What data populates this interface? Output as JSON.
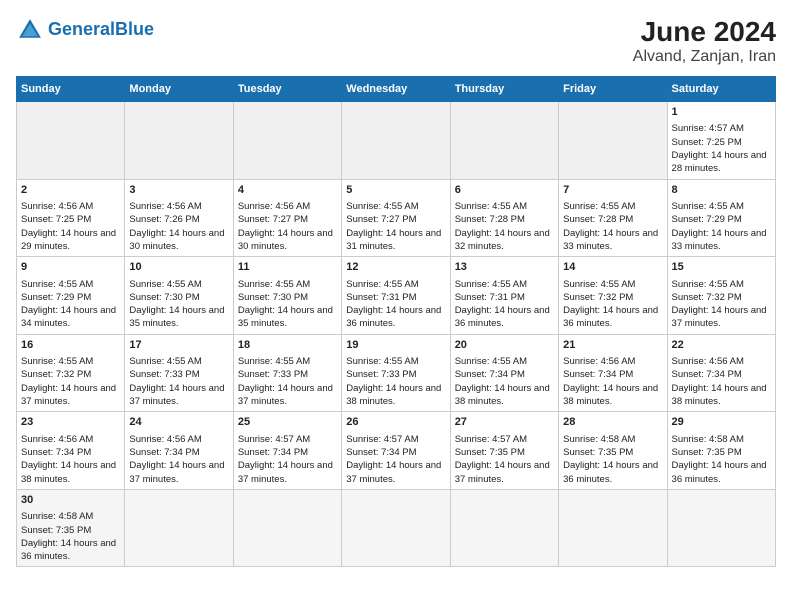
{
  "header": {
    "logo_general": "General",
    "logo_blue": "Blue",
    "title": "June 2024",
    "subtitle": "Alvand, Zanjan, Iran"
  },
  "weekdays": [
    "Sunday",
    "Monday",
    "Tuesday",
    "Wednesday",
    "Thursday",
    "Friday",
    "Saturday"
  ],
  "weeks": [
    [
      {
        "day": "",
        "info": ""
      },
      {
        "day": "",
        "info": ""
      },
      {
        "day": "",
        "info": ""
      },
      {
        "day": "",
        "info": ""
      },
      {
        "day": "",
        "info": ""
      },
      {
        "day": "",
        "info": ""
      },
      {
        "day": "1",
        "info": "Sunrise: 4:57 AM\nSunset: 7:25 PM\nDaylight: 14 hours and 28 minutes."
      }
    ],
    [
      {
        "day": "2",
        "info": "Sunrise: 4:56 AM\nSunset: 7:25 PM\nDaylight: 14 hours and 29 minutes."
      },
      {
        "day": "3",
        "info": "Sunrise: 4:56 AM\nSunset: 7:26 PM\nDaylight: 14 hours and 30 minutes."
      },
      {
        "day": "4",
        "info": "Sunrise: 4:56 AM\nSunset: 7:27 PM\nDaylight: 14 hours and 30 minutes."
      },
      {
        "day": "5",
        "info": "Sunrise: 4:55 AM\nSunset: 7:27 PM\nDaylight: 14 hours and 31 minutes."
      },
      {
        "day": "6",
        "info": "Sunrise: 4:55 AM\nSunset: 7:28 PM\nDaylight: 14 hours and 32 minutes."
      },
      {
        "day": "7",
        "info": "Sunrise: 4:55 AM\nSunset: 7:28 PM\nDaylight: 14 hours and 33 minutes."
      },
      {
        "day": "8",
        "info": "Sunrise: 4:55 AM\nSunset: 7:29 PM\nDaylight: 14 hours and 33 minutes."
      }
    ],
    [
      {
        "day": "9",
        "info": "Sunrise: 4:55 AM\nSunset: 7:29 PM\nDaylight: 14 hours and 34 minutes."
      },
      {
        "day": "10",
        "info": "Sunrise: 4:55 AM\nSunset: 7:30 PM\nDaylight: 14 hours and 35 minutes."
      },
      {
        "day": "11",
        "info": "Sunrise: 4:55 AM\nSunset: 7:30 PM\nDaylight: 14 hours and 35 minutes."
      },
      {
        "day": "12",
        "info": "Sunrise: 4:55 AM\nSunset: 7:31 PM\nDaylight: 14 hours and 36 minutes."
      },
      {
        "day": "13",
        "info": "Sunrise: 4:55 AM\nSunset: 7:31 PM\nDaylight: 14 hours and 36 minutes."
      },
      {
        "day": "14",
        "info": "Sunrise: 4:55 AM\nSunset: 7:32 PM\nDaylight: 14 hours and 36 minutes."
      },
      {
        "day": "15",
        "info": "Sunrise: 4:55 AM\nSunset: 7:32 PM\nDaylight: 14 hours and 37 minutes."
      }
    ],
    [
      {
        "day": "16",
        "info": "Sunrise: 4:55 AM\nSunset: 7:32 PM\nDaylight: 14 hours and 37 minutes."
      },
      {
        "day": "17",
        "info": "Sunrise: 4:55 AM\nSunset: 7:33 PM\nDaylight: 14 hours and 37 minutes."
      },
      {
        "day": "18",
        "info": "Sunrise: 4:55 AM\nSunset: 7:33 PM\nDaylight: 14 hours and 37 minutes."
      },
      {
        "day": "19",
        "info": "Sunrise: 4:55 AM\nSunset: 7:33 PM\nDaylight: 14 hours and 38 minutes."
      },
      {
        "day": "20",
        "info": "Sunrise: 4:55 AM\nSunset: 7:34 PM\nDaylight: 14 hours and 38 minutes."
      },
      {
        "day": "21",
        "info": "Sunrise: 4:56 AM\nSunset: 7:34 PM\nDaylight: 14 hours and 38 minutes."
      },
      {
        "day": "22",
        "info": "Sunrise: 4:56 AM\nSunset: 7:34 PM\nDaylight: 14 hours and 38 minutes."
      }
    ],
    [
      {
        "day": "23",
        "info": "Sunrise: 4:56 AM\nSunset: 7:34 PM\nDaylight: 14 hours and 38 minutes."
      },
      {
        "day": "24",
        "info": "Sunrise: 4:56 AM\nSunset: 7:34 PM\nDaylight: 14 hours and 37 minutes."
      },
      {
        "day": "25",
        "info": "Sunrise: 4:57 AM\nSunset: 7:34 PM\nDaylight: 14 hours and 37 minutes."
      },
      {
        "day": "26",
        "info": "Sunrise: 4:57 AM\nSunset: 7:34 PM\nDaylight: 14 hours and 37 minutes."
      },
      {
        "day": "27",
        "info": "Sunrise: 4:57 AM\nSunset: 7:35 PM\nDaylight: 14 hours and 37 minutes."
      },
      {
        "day": "28",
        "info": "Sunrise: 4:58 AM\nSunset: 7:35 PM\nDaylight: 14 hours and 36 minutes."
      },
      {
        "day": "29",
        "info": "Sunrise: 4:58 AM\nSunset: 7:35 PM\nDaylight: 14 hours and 36 minutes."
      }
    ],
    [
      {
        "day": "30",
        "info": "Sunrise: 4:58 AM\nSunset: 7:35 PM\nDaylight: 14 hours and 36 minutes."
      },
      {
        "day": "",
        "info": ""
      },
      {
        "day": "",
        "info": ""
      },
      {
        "day": "",
        "info": ""
      },
      {
        "day": "",
        "info": ""
      },
      {
        "day": "",
        "info": ""
      },
      {
        "day": "",
        "info": ""
      }
    ]
  ]
}
